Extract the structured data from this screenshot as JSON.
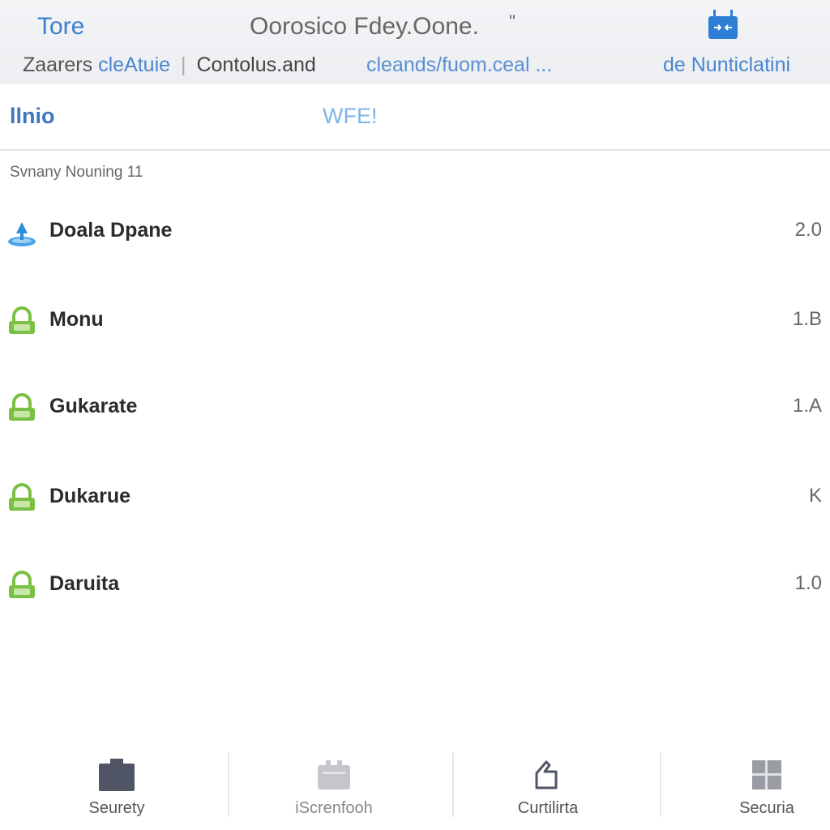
{
  "header": {
    "back_label": "Tore",
    "title": "Oorosico Fdey.Oone.",
    "title_mark": "\"",
    "action_icon": "transfer-icon",
    "crumb_a": "Zaarers",
    "crumb_b": "cleAtuie",
    "crumb_sep": "|",
    "crumb_c": "Contolus.and",
    "crumb_mid": "cleands/fuom.ceal ...",
    "crumb_right": "de Nunticlatini"
  },
  "tabs": {
    "primary": "llnio",
    "secondary": "WFE!"
  },
  "section": {
    "label": "Svnany Nouning 11"
  },
  "items": [
    {
      "label": "Doala Dpane",
      "value": "2.0",
      "icon": "drive-upload-icon"
    },
    {
      "label": "Monu",
      "value": "1.B",
      "icon": "lock-icon"
    },
    {
      "label": "Gukarate",
      "value": "1.A",
      "icon": "lock-icon"
    },
    {
      "label": "Dukarue",
      "value": "K",
      "icon": "lock-icon"
    },
    {
      "label": "Daruita",
      "value": "1.0",
      "icon": "lock-icon"
    }
  ],
  "bottom_nav": [
    {
      "label": "Seurety",
      "icon": "briefcase-icon"
    },
    {
      "label": "iScrenfooh",
      "icon": "screen-icon"
    },
    {
      "label": "Curtilirta",
      "icon": "cursor-icon"
    },
    {
      "label": "Securia",
      "icon": "grid-icon"
    }
  ],
  "colors": {
    "accent": "#3d7fd1",
    "lock_green": "#7ac043",
    "header_bg": "#eef0f3"
  }
}
